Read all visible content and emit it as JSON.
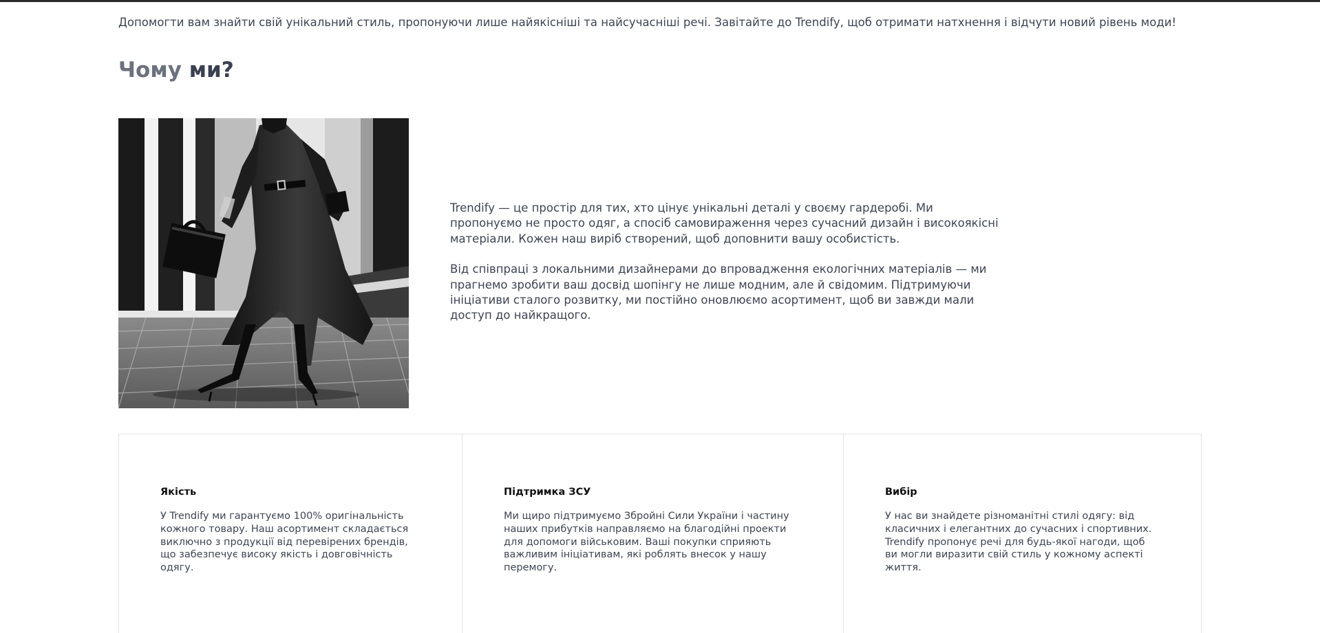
{
  "intro": {
    "text": "Допомогти вам знайти свій унікальний стиль, пропонуючи лише найякісніші та найсучасніші речі. Завітайте до Trendify, щоб отримати натхнення і відчути новий рівень моди!"
  },
  "why": {
    "heading_light": "Чому",
    "heading_dark": "ми?"
  },
  "about": {
    "paragraphs": [
      "Trendify — це простір для тих, хто цінує унікальні деталі у своєму гардеробі. Ми пропонуємо не просто одяг, а спосіб самовираження через сучасний дизайн і високоякісні матеріали. Кожен наш виріб створений, щоб доповнити вашу особистість.",
      "Від співпраці з локальними дизайнерами до впровадження екологічних матеріалів — ми прагнемо зробити ваш досвід шопінгу не лише модним, але й свідомим. Підтримуючи ініціативи сталого розвитку, ми постійно оновлюємо асортимент, щоб ви завжди мали доступ до найкращого."
    ]
  },
  "features": [
    {
      "title": "Якість",
      "text": "У Trendify ми гарантуємо 100% оригінальність кожного товару. Наш асортимент складається виключно з продукції від перевірених брендів, що забезпечує високу якість і довговічність одягу."
    },
    {
      "title": "Підтримка ЗСУ",
      "text": "Ми щиро підтримуємо Збройні Сили України і частину наших прибутків направляємо на благодійні проекти для допомоги військовим. Ваші покупки сприяють важливим ініціативам, які роблять внесок у нашу перемогу."
    },
    {
      "title": "Вибір",
      "text": "У нас ви знайдете різноманітні стилі одягу: від класичних і елегантних до сучасних і спортивних. Trendify пропонує речі для будь-якої нагоди, щоб ви могли виразити свій стиль у кожному аспекті життя."
    }
  ],
  "colors": {
    "text": "#3d4452",
    "heading_light": "#6b727d",
    "heading_dark": "#3a4150",
    "border": "#e2e2e2"
  }
}
